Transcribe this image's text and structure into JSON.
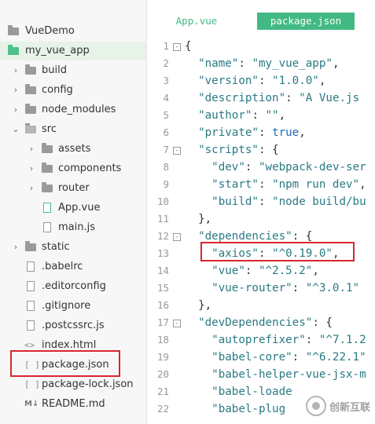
{
  "sidebar": {
    "items": [
      {
        "label": "VueDemo",
        "icon": "folder-icon"
      },
      {
        "label": "my_vue_app",
        "icon": "project-folder-icon"
      },
      {
        "label": "build",
        "icon": "folder-icon"
      },
      {
        "label": "config",
        "icon": "folder-icon"
      },
      {
        "label": "node_modules",
        "icon": "folder-icon"
      },
      {
        "label": "src",
        "icon": "folder-open-icon"
      },
      {
        "label": "assets",
        "icon": "folder-icon"
      },
      {
        "label": "components",
        "icon": "folder-icon"
      },
      {
        "label": "router",
        "icon": "folder-icon"
      },
      {
        "label": "App.vue",
        "icon": "vue-file-icon"
      },
      {
        "label": "main.js",
        "icon": "js-file-icon"
      },
      {
        "label": "static",
        "icon": "folder-icon"
      },
      {
        "label": ".babelrc",
        "icon": "file-icon"
      },
      {
        "label": ".editorconfig",
        "icon": "file-icon"
      },
      {
        "label": ".gitignore",
        "icon": "file-icon"
      },
      {
        "label": ".postcssrc.js",
        "icon": "js-file-icon"
      },
      {
        "label": "index.html",
        "icon": "html-file-icon"
      },
      {
        "label": "package.json",
        "icon": "json-file-icon"
      },
      {
        "label": "package-lock.json",
        "icon": "json-file-icon"
      },
      {
        "label": "README.md",
        "icon": "markdown-file-icon"
      }
    ]
  },
  "tabs": [
    {
      "label": "App.vue",
      "active": false
    },
    {
      "label": "package.json",
      "active": true
    }
  ],
  "editor": {
    "lines": [
      {
        "n": "1",
        "text": "{"
      },
      {
        "n": "2",
        "text": "  \"name\": \"my_vue_app\","
      },
      {
        "n": "3",
        "text": "  \"version\": \"1.0.0\","
      },
      {
        "n": "4",
        "text": "  \"description\": \"A Vue.js"
      },
      {
        "n": "5",
        "text": "  \"author\": \"\","
      },
      {
        "n": "6",
        "text": "  \"private\": true,"
      },
      {
        "n": "7",
        "text": "  \"scripts\": {"
      },
      {
        "n": "8",
        "text": "    \"dev\": \"webpack-dev-ser"
      },
      {
        "n": "9",
        "text": "    \"start\": \"npm run dev\","
      },
      {
        "n": "10",
        "text": "    \"build\": \"node build/bu"
      },
      {
        "n": "11",
        "text": "  },"
      },
      {
        "n": "12",
        "text": "  \"dependencies\": {"
      },
      {
        "n": "13",
        "text": "    \"axios\": \"^0.19.0\","
      },
      {
        "n": "14",
        "text": "    \"vue\": \"^2.5.2\","
      },
      {
        "n": "15",
        "text": "    \"vue-router\": \"^3.0.1\""
      },
      {
        "n": "16",
        "text": "  },"
      },
      {
        "n": "17",
        "text": "  \"devDependencies\": {"
      },
      {
        "n": "18",
        "text": "    \"autoprefixer\": \"^7.1.2"
      },
      {
        "n": "19",
        "text": "    \"babel-core\": \"^6.22.1\""
      },
      {
        "n": "20",
        "text": "    \"babel-helper-vue-jsx-m"
      },
      {
        "n": "21",
        "text": "    \"babel-loade"
      },
      {
        "n": "22",
        "text": "    \"babel-plug"
      }
    ]
  },
  "watermark": {
    "text": "创新互联"
  },
  "colors": {
    "accent": "#42b983",
    "highlight": "#d9262f",
    "selected_row": "#e7f3e8"
  }
}
